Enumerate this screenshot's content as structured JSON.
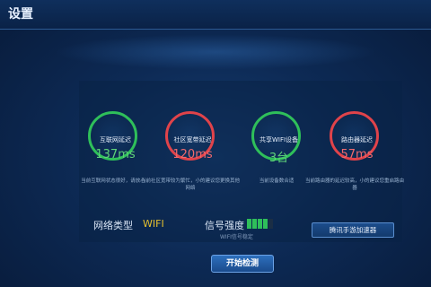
{
  "header": {
    "title": "设置"
  },
  "tiles": [
    {
      "label": "互联网延迟",
      "value": "137ms",
      "status": "green",
      "note": "当前互联网状态很好，请放心"
    },
    {
      "label": "社区宽带延迟",
      "value": "120ms",
      "status": "red",
      "note": "当前社区宽带较为繁忙，小的建议您更换其他网络"
    },
    {
      "label": "共享WIFI设备",
      "value": "3台",
      "status": "green",
      "note": "当前设备数合适"
    },
    {
      "label": "路由器延迟",
      "value": "57ms",
      "status": "red",
      "note": "当前路由器的延迟较高，小的建议您重启路由器"
    }
  ],
  "network": {
    "label": "网络类型",
    "value": "WIFI"
  },
  "signal": {
    "label": "信号强度",
    "level_bars": 4,
    "max_bars": 5,
    "sublabel": "WIFI信号稳定"
  },
  "buttons": {
    "accelerator": "腾讯手游加速器",
    "start": "开始检测"
  },
  "colors": {
    "good": "#2fbf5a",
    "bad": "#e0434a",
    "accent": "#e6c12e"
  }
}
